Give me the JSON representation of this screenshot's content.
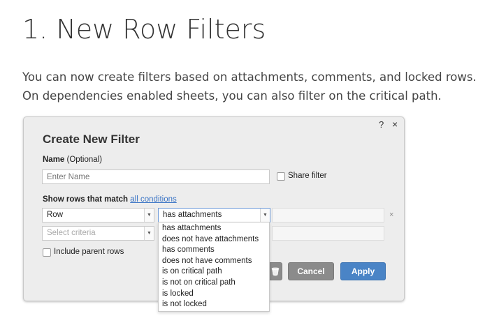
{
  "heading": "1. New Row Filters",
  "intro": {
    "line1": "You can now create filters based on attachments, comments, and locked rows.",
    "line2": "On dependencies enabled sheets, you can also filter on the critical path."
  },
  "dialog": {
    "help": "?",
    "close": "×",
    "title": "Create New Filter",
    "name_label": "Name",
    "name_optional": "(Optional)",
    "name_placeholder": "Enter Name",
    "share_filter_label": "Share filter",
    "match_label": "Show rows that match",
    "match_link": "all conditions",
    "row1": {
      "field_value": "Row",
      "condition_value": "has attachments",
      "remove": "×"
    },
    "row2": {
      "field_placeholder": "Select criteria"
    },
    "include_parent_label": "Include parent rows",
    "cancel_label": "Cancel",
    "apply_label": "Apply",
    "dropdown_options": [
      "has attachments",
      "does not have attachments",
      "has comments",
      "does not have comments",
      "is on critical path",
      "is not on critical path",
      "is locked",
      "is not locked"
    ]
  },
  "colors": {
    "apply": "#4a84c6",
    "cancel": "#8b8b8b",
    "link": "#3a74c5",
    "dialog_bg": "#ededed"
  }
}
